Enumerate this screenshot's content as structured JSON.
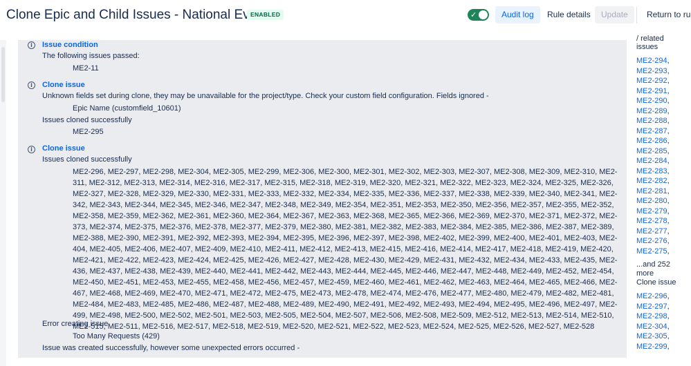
{
  "header": {
    "title": "Clone Epic and Child Issues - National Events",
    "status_badge": "ENABLED",
    "toggle_on": true,
    "audit_log": "Audit log",
    "rule_details": "Rule details",
    "update": "Update",
    "return_to_rules": "Return to rules"
  },
  "log": {
    "block1": {
      "title": "Issue condition",
      "text": "The following issues passed:",
      "issue": "ME2-11"
    },
    "block2": {
      "title": "Clone issue",
      "warning": "Unknown fields set during clone, they may be unavailable for the project/type. Check your custom field configuration. Fields ignored -",
      "field": "Epic Name (customfield_10601)",
      "cloned_label": "Issues cloned successfully",
      "cloned_issue": "ME2-295"
    },
    "block3": {
      "title": "Clone issue",
      "cloned_label": "Issues cloned successfully",
      "cloned_issues": "ME2-296, ME2-297, ME2-298, ME2-304, ME2-305, ME2-299, ME2-306, ME2-300, ME2-301, ME2-302, ME2-303, ME2-307, ME2-308, ME2-309, ME2-310, ME2-311, ME2-312, ME2-313, ME2-314, ME2-316, ME2-317, ME2-315, ME2-318, ME2-319, ME2-320, ME2-321, ME2-322, ME2-323, ME2-324, ME2-325, ME2-326, ME2-327, ME2-328, ME2-329, ME2-330, ME2-331, ME2-333, ME2-332, ME2-334, ME2-335, ME2-336, ME2-337, ME2-338, ME2-339, ME2-340, ME2-341, ME2-342, ME2-343, ME2-344, ME2-345, ME2-346, ME2-347, ME2-348, ME2-349, ME2-354, ME2-351, ME2-353, ME2-350, ME2-356, ME2-357, ME2-355, ME2-352, ME2-358, ME2-359, ME2-362, ME2-361, ME2-360, ME2-364, ME2-367, ME2-363, ME2-368, ME2-365, ME2-366, ME2-369, ME2-370, ME2-371, ME2-372, ME2-373, ME2-374, ME2-375, ME2-376, ME2-378, ME2-377, ME2-379, ME2-380, ME2-381, ME2-382, ME2-383, ME2-384, ME2-385, ME2-386, ME2-387, ME2-389, ME2-388, ME2-390, ME2-391, ME2-392, ME2-393, ME2-394, ME2-395, ME2-396, ME2-397, ME2-398, ME2-402, ME2-399, ME2-400, ME2-401, ME2-403, ME2-404, ME2-405, ME2-406, ME2-407, ME2-409, ME2-410, ME2-411, ME2-412, ME2-413, ME2-415, ME2-416, ME2-414, ME2-417, ME2-418, ME2-419, ME2-420, ME2-421, ME2-422, ME2-423, ME2-424, ME2-425, ME2-426, ME2-427, ME2-428, ME2-430, ME2-429, ME2-431, ME2-432, ME2-434, ME2-433, ME2-435, ME2-436, ME2-437, ME2-438, ME2-439, ME2-440, ME2-441, ME2-442, ME2-443, ME2-444, ME2-445, ME2-446, ME2-447, ME2-448, ME2-449, ME2-452, ME2-454, ME2-450, ME2-451, ME2-453, ME2-455, ME2-458, ME2-456, ME2-457, ME2-459, ME2-460, ME2-461, ME2-462, ME2-463, ME2-464, ME2-465, ME2-466, ME2-467, ME2-468, ME2-469, ME2-470, ME2-471, ME2-472, ME2-475, ME2-473, ME2-478, ME2-474, ME2-476, ME2-477, ME2-480, ME2-479, ME2-482, ME2-481, ME2-484, ME2-483, ME2-485, ME2-486, ME2-487, ME2-488, ME2-489, ME2-490, ME2-491, ME2-492, ME2-493, ME2-494, ME2-495, ME2-496, ME2-497, ME2-499, ME2-498, ME2-500, ME2-502, ME2-501, ME2-503, ME2-505, ME2-504, ME2-507, ME2-506, ME2-508, ME2-509, ME2-512, ME2-513, ME2-514, ME2-510, ME2-515, ME2-511, ME2-516, ME2-517, ME2-518, ME2-519, ME2-520, ME2-521, ME2-522, ME2-523, ME2-524, ME2-525, ME2-526, ME2-527, ME2-528",
      "error_label": "Error creating issue",
      "error_detail": "Too Many Requests (429)",
      "final_note": "Issue was created successfully, however some unexpected errors occurred -"
    }
  },
  "related": {
    "header_line1": "/ related",
    "header_line2": "issues",
    "links_group1": [
      "ME2-294",
      "ME2-293",
      "ME2-292",
      "ME2-291",
      "ME2-290",
      "ME2-289",
      "ME2-288",
      "ME2-287",
      "ME2-286",
      "ME2-285",
      "ME2-284",
      "ME2-283",
      "ME2-282",
      "ME2-281",
      "ME2-280",
      "ME2-279",
      "ME2-278",
      "ME2-277",
      "ME2-276",
      "ME2-275"
    ],
    "more_line1": "...and 252",
    "more_line2": "more",
    "more_line3": "Clone issue",
    "links_group2": [
      "ME2-296",
      "ME2-297",
      "ME2-298",
      "ME2-304",
      "ME2-305",
      "ME2-299"
    ]
  }
}
